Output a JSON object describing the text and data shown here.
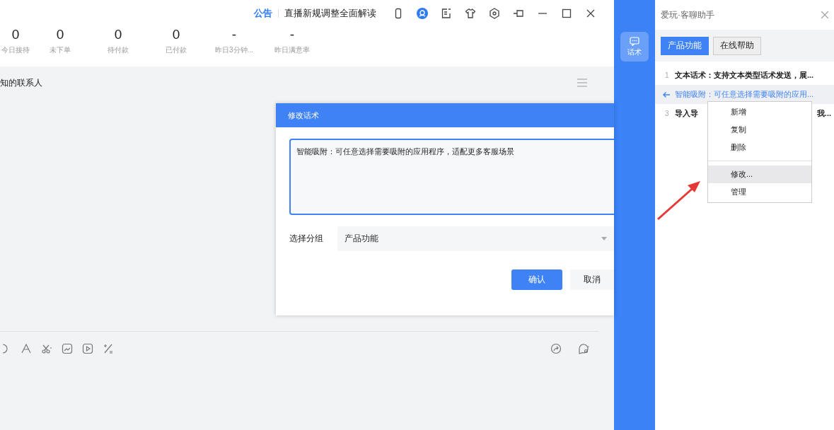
{
  "top_bar": {
    "notice_label": "公告",
    "notice_text": "直播新规调整全面解读"
  },
  "stats": [
    {
      "value": "0",
      "label": "今日接待"
    },
    {
      "value": "0",
      "label": "未下单"
    },
    {
      "value": "0",
      "label": "待付款"
    },
    {
      "value": "0",
      "label": "已付款"
    },
    {
      "value": "-",
      "label": "昨日3分钟..."
    },
    {
      "value": "-",
      "label": "昨日满意率"
    }
  ],
  "contact_header": {
    "title": "知的联系人"
  },
  "dialog": {
    "title": "修改话术",
    "text": "智能吸附：可任意选择需要吸附的应用程序，适配更多客服场景",
    "focused": true,
    "group_label": "选择分组",
    "group_value": "产品功能",
    "buttons": [
      {
        "label": "确认",
        "kind": "primary"
      },
      {
        "label": "取消",
        "kind": "secondary"
      }
    ]
  },
  "side_strip": {
    "items": [
      {
        "label": "话术",
        "selected": true
      }
    ]
  },
  "assistant": {
    "title": "爱玩·客聊助手",
    "tabs": [
      {
        "label": "产品功能",
        "selected": true
      },
      {
        "label": "在线帮助",
        "selected": false
      }
    ],
    "items": [
      {
        "index": "1",
        "text": "文本话术：支持文本类型话术发送，展...",
        "selected": false
      },
      {
        "text": "智能吸附：可任意选择需要吸附的应用...",
        "selected": true
      },
      {
        "index": "3",
        "text": "导入导",
        "text_end": "我...",
        "selected": false
      }
    ]
  },
  "context_menu": {
    "items": [
      {
        "kind": "item",
        "label": "新增",
        "selected": false
      },
      {
        "kind": "item",
        "label": "复制",
        "selected": false
      },
      {
        "kind": "item",
        "label": "删除",
        "selected": false
      },
      {
        "kind": "separator"
      },
      {
        "kind": "item",
        "label": "修改...",
        "selected": true
      },
      {
        "kind": "item",
        "label": "管理",
        "selected": false
      }
    ]
  }
}
